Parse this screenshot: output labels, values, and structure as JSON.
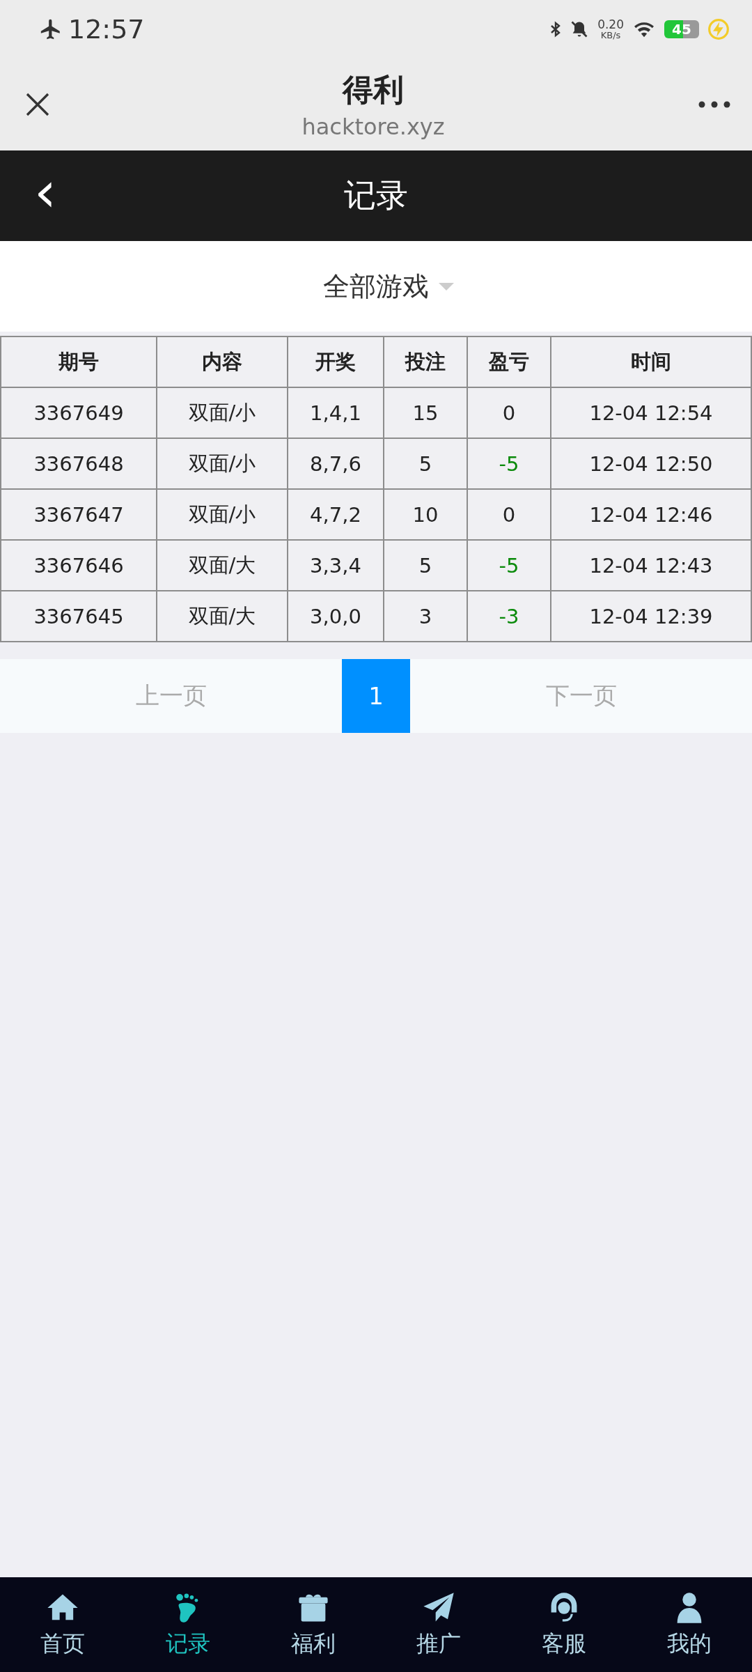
{
  "status_bar": {
    "time": "12:57",
    "speed_value": "0.20",
    "speed_unit": "KB/s",
    "battery": "45"
  },
  "browser": {
    "title": "得利",
    "url": "hacktore.xyz"
  },
  "page_header": {
    "back": "‹",
    "title": "记录"
  },
  "filter": {
    "label": "全部游戏"
  },
  "table": {
    "columns": [
      "期号",
      "内容",
      "开奖",
      "投注",
      "盈亏",
      "时间"
    ],
    "rows": [
      {
        "issue": "3367649",
        "content": "双面/小",
        "draw": "1,4,1",
        "bet": "15",
        "profit": {
          "text": "0",
          "color": "#222222"
        },
        "time": "12-04 12:54"
      },
      {
        "issue": "3367648",
        "content": "双面/小",
        "draw": "8,7,6",
        "bet": "5",
        "profit": {
          "text": "-5",
          "color": "#0a8a0a"
        },
        "time": "12-04 12:50"
      },
      {
        "issue": "3367647",
        "content": "双面/小",
        "draw": "4,7,2",
        "bet": "10",
        "profit": {
          "text": "0",
          "color": "#222222"
        },
        "time": "12-04 12:46"
      },
      {
        "issue": "3367646",
        "content": "双面/大",
        "draw": "3,3,4",
        "bet": "5",
        "profit": {
          "text": "-5",
          "color": "#0a8a0a"
        },
        "time": "12-04 12:43"
      },
      {
        "issue": "3367645",
        "content": "双面/大",
        "draw": "3,0,0",
        "bet": "3",
        "profit": {
          "text": "-3",
          "color": "#0a8a0a"
        },
        "time": "12-04 12:39"
      }
    ]
  },
  "pagination": {
    "prev": "上一页",
    "pages": [
      {
        "label": "1",
        "selected": true
      }
    ],
    "next": "下一页"
  },
  "tab_bar": [
    {
      "label": "首页",
      "selected": false
    },
    {
      "label": "记录",
      "selected": true
    },
    {
      "label": "福利",
      "selected": false
    },
    {
      "label": "推广",
      "selected": false
    },
    {
      "label": "客服",
      "selected": false
    },
    {
      "label": "我的",
      "selected": false
    }
  ]
}
